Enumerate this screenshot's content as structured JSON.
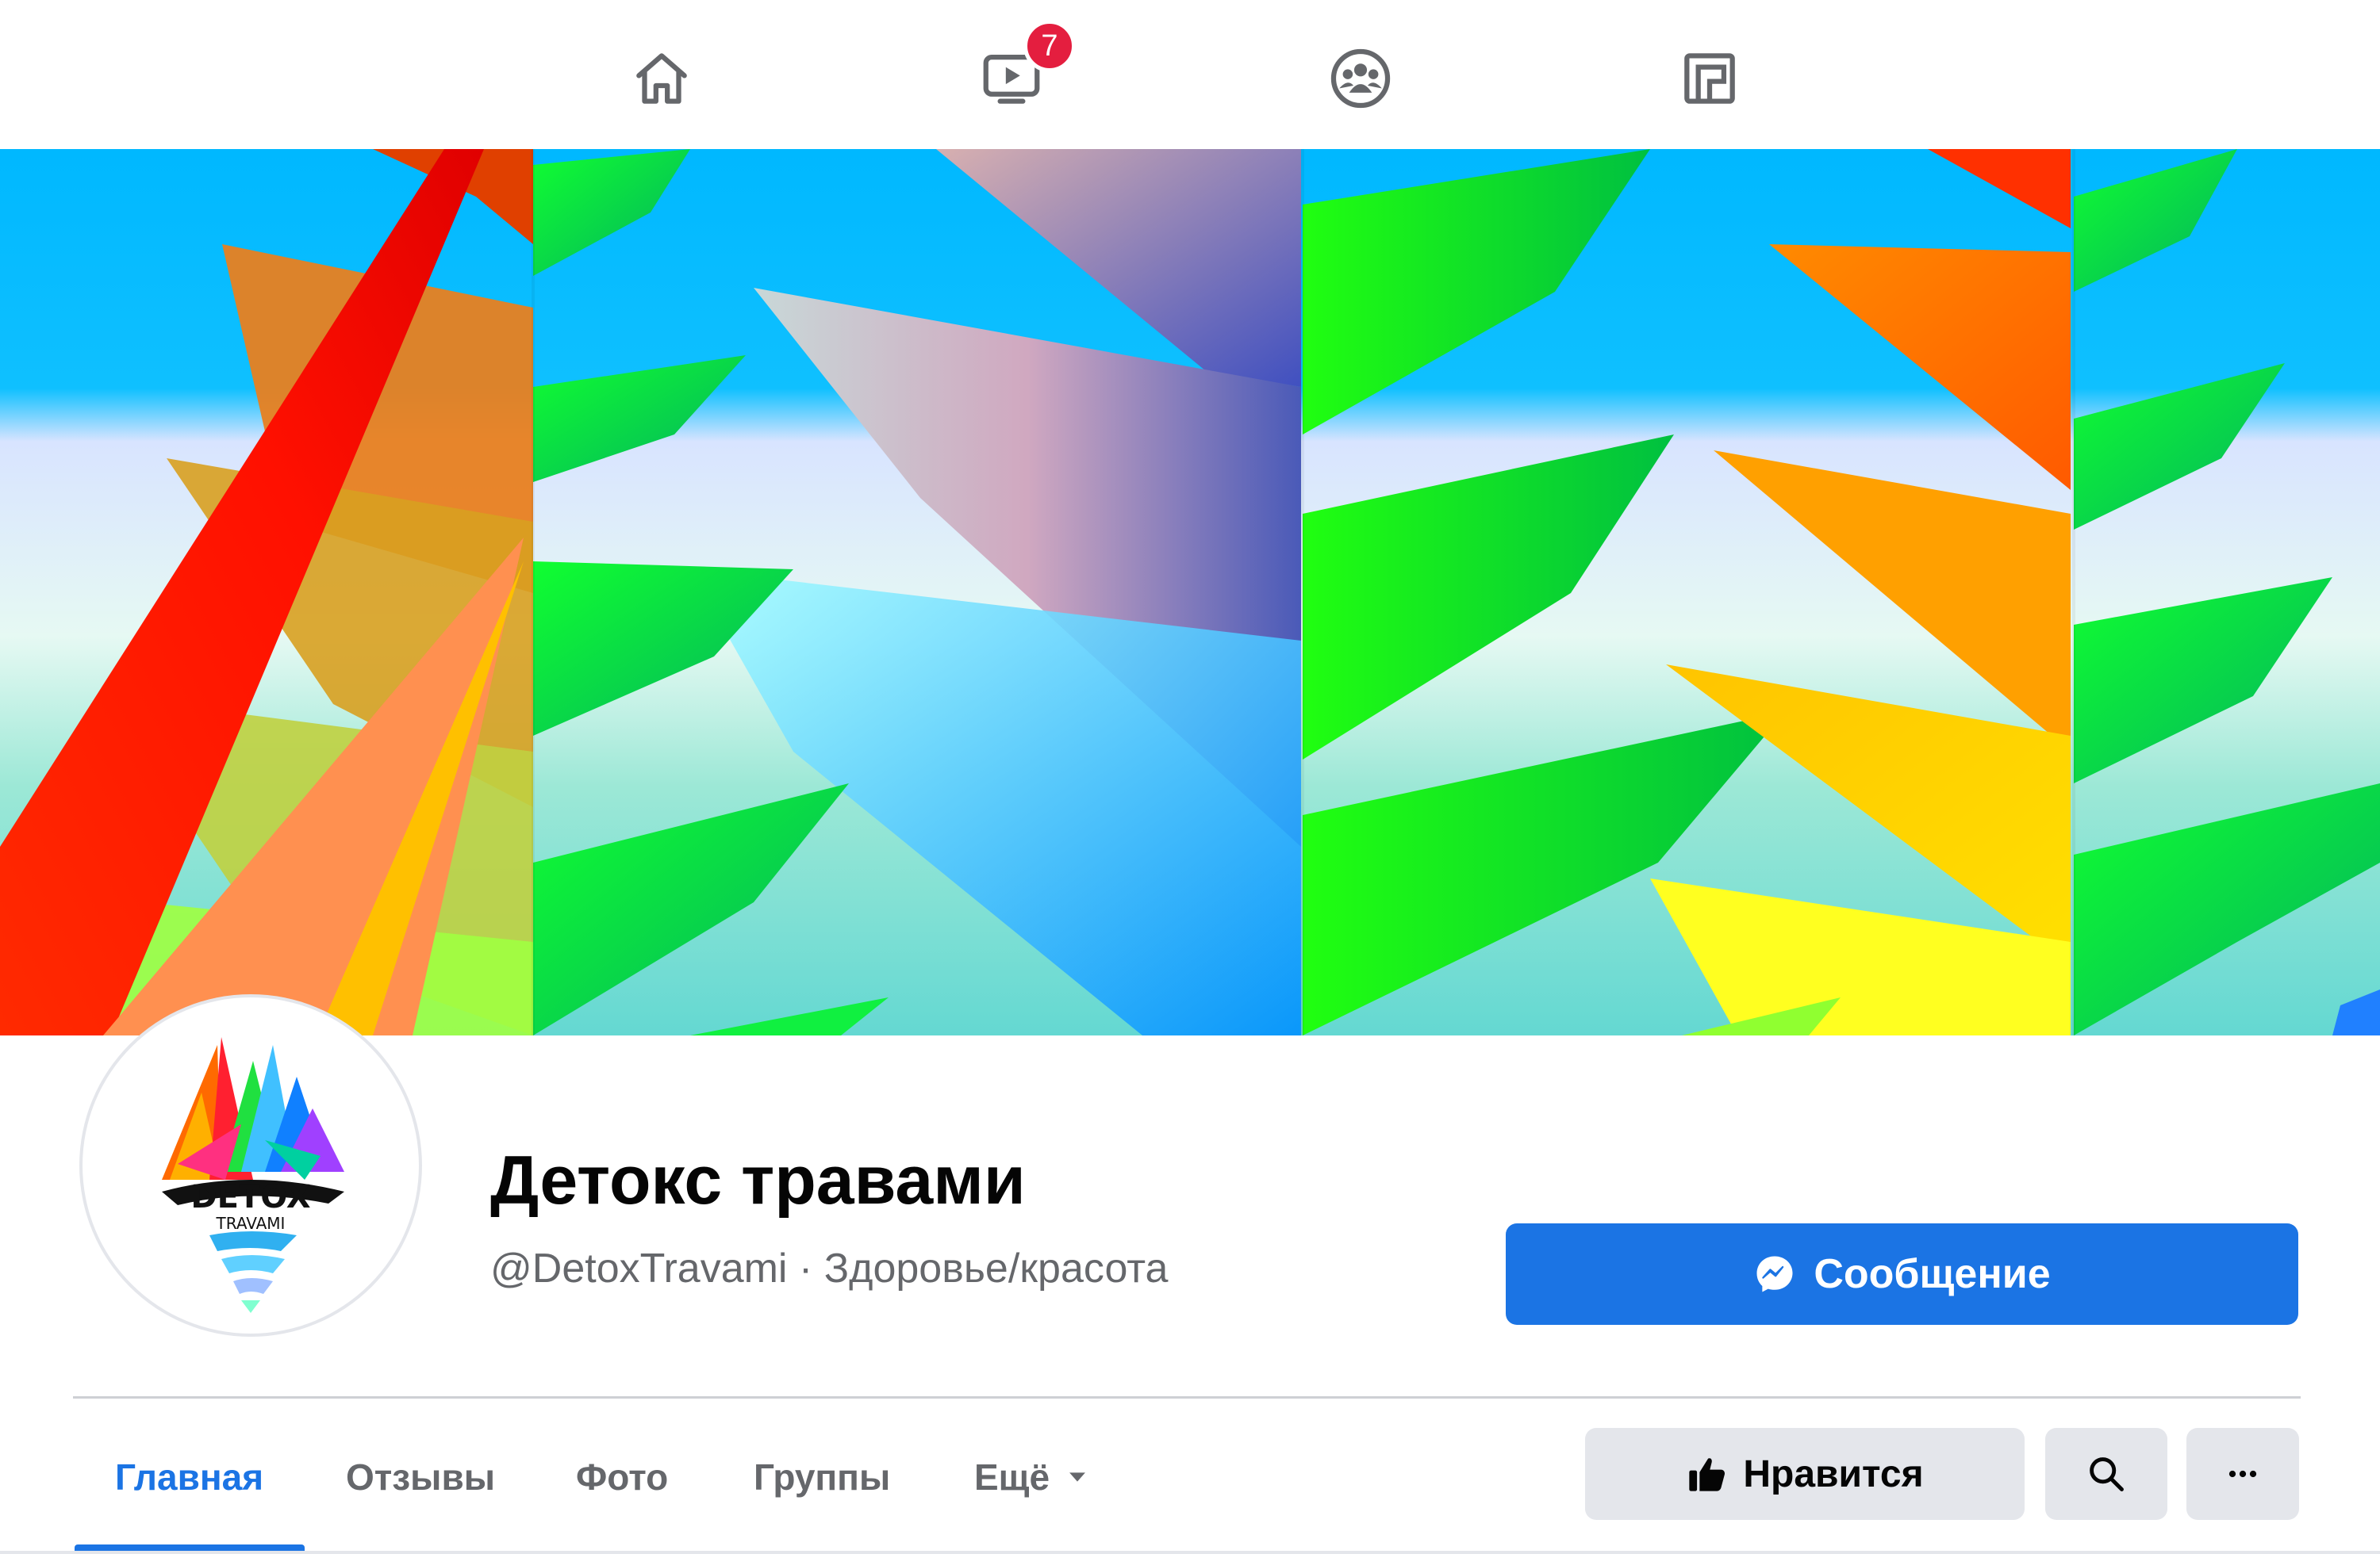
{
  "nav": {
    "items": [
      {
        "name": "home",
        "icon": "home-icon"
      },
      {
        "name": "watch",
        "icon": "video-icon",
        "badge": "7"
      },
      {
        "name": "groups",
        "icon": "groups-icon"
      },
      {
        "name": "gaming",
        "icon": "gaming-icon"
      }
    ],
    "watch_badge": "7"
  },
  "profile": {
    "name": "Детокс травами",
    "subtitle": "@DetoxTravami · Здоровье/красота",
    "logo_text": "DETOX",
    "logo_subtext": "TRAVAMI"
  },
  "actions": {
    "message_label": "Сообщение",
    "like_label": "Нравится"
  },
  "tabs": [
    {
      "label": "Главная",
      "active": true
    },
    {
      "label": "Отзывы",
      "active": false
    },
    {
      "label": "Фото",
      "active": false
    },
    {
      "label": "Группы",
      "active": false
    },
    {
      "label": "Ещё",
      "active": false
    }
  ],
  "colors": {
    "accent": "#1b74e4",
    "badge": "#e41e3f",
    "secondary_text": "#65676b",
    "button_gray": "#e4e6eb"
  }
}
